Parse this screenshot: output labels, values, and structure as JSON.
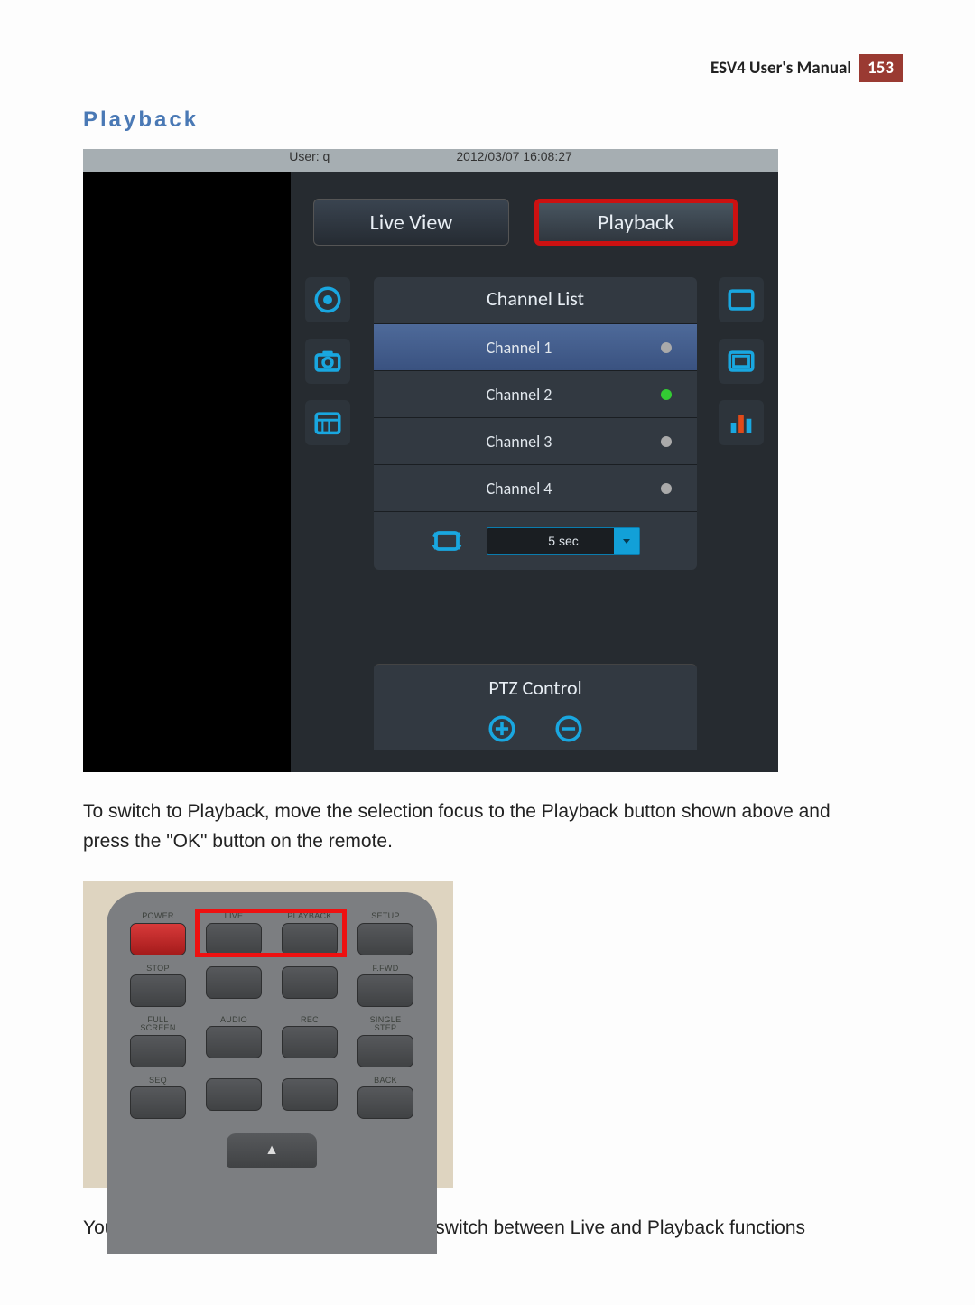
{
  "header": {
    "title": "ESV4 User's Manual",
    "page": "153"
  },
  "section_title": "Playback",
  "app": {
    "topbar": {
      "user": "User: q",
      "datetime": "2012/03/07 16:08:27"
    },
    "tabs": {
      "live": "Live View",
      "playback": "Playback"
    },
    "channel_list": {
      "header": "Channel List",
      "items": [
        {
          "label": "Channel 1",
          "status": "off",
          "selected": true
        },
        {
          "label": "Channel 2",
          "status": "on",
          "selected": false
        },
        {
          "label": "Channel 3",
          "status": "off",
          "selected": false
        },
        {
          "label": "Channel 4",
          "status": "off",
          "selected": false
        }
      ],
      "dwell": "5 sec"
    },
    "ptz": {
      "header": "PTZ Control"
    }
  },
  "para1": "To switch to Playback, move the selection focus to the Playback button shown above and press the \"OK\" button on the remote.",
  "remote": {
    "buttons": [
      [
        "POWER",
        "LIVE",
        "PLAYBACK",
        "SETUP"
      ],
      [
        "STOP",
        "",
        "",
        "F.FWD"
      ],
      [
        "FULL\nSCREEN",
        "AUDIO",
        "REC",
        "SINGLE\nSTEP"
      ],
      [
        "SEQ",
        "",
        "",
        "BACK"
      ]
    ]
  },
  "para2": "You can always use the remote to quickly switch between Live and Playback functions"
}
